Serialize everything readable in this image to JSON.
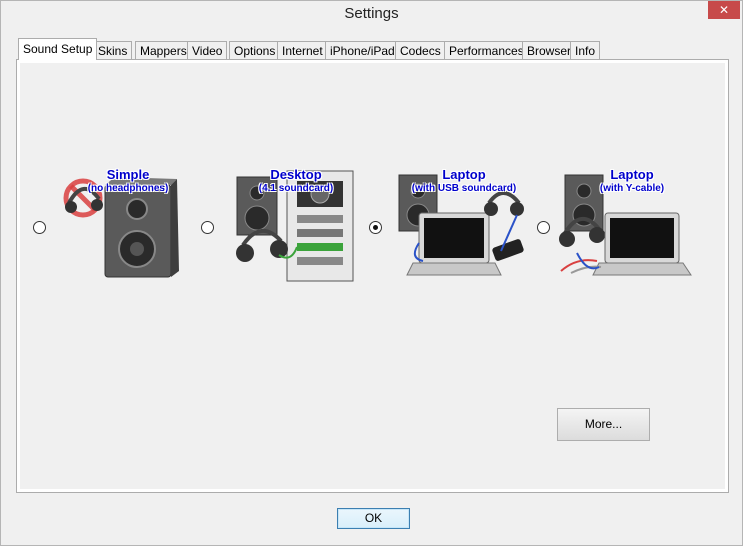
{
  "window": {
    "title": "Settings",
    "close_glyph": "✕"
  },
  "tabs": [
    {
      "label": "Sound Setup",
      "active": true
    },
    {
      "label": "Skins"
    },
    {
      "label": "Mappers"
    },
    {
      "label": "Video"
    },
    {
      "label": "Options"
    },
    {
      "label": "Internet"
    },
    {
      "label": "iPhone/iPad"
    },
    {
      "label": "Codecs"
    },
    {
      "label": "Performances"
    },
    {
      "label": "Browser"
    },
    {
      "label": "Info"
    }
  ],
  "sound_setup": {
    "options": [
      {
        "title": "Simple",
        "subtitle": "(no headphones)",
        "checked": false,
        "icon": "speaker-no-headphones-icon"
      },
      {
        "title": "Desktop",
        "subtitle": "(4.1 soundcard)",
        "checked": false,
        "icon": "desktop-soundcard-icon"
      },
      {
        "title": "Laptop",
        "subtitle": "(with USB soundcard)",
        "checked": true,
        "icon": "laptop-usb-soundcard-icon"
      },
      {
        "title": "Laptop",
        "subtitle": "(with Y-cable)",
        "checked": false,
        "icon": "laptop-y-cable-icon"
      }
    ],
    "more_label": "More..."
  },
  "footer": {
    "ok_label": "OK"
  },
  "colors": {
    "accent_text": "#0000cc",
    "close": "#c74a4a"
  }
}
